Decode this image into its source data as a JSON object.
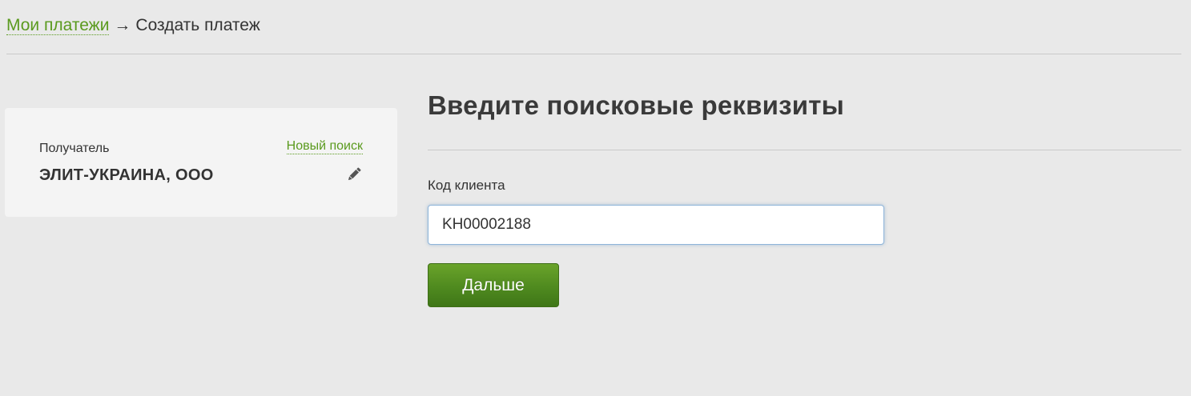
{
  "breadcrumb": {
    "link_label": "Мои платежи",
    "arrow": "→",
    "current": "Создать платеж"
  },
  "recipient": {
    "label": "Получатель",
    "new_search_label": "Новый поиск",
    "name": "ЭЛИТ-УКРАИНА, ООО",
    "edit_icon": "pencil-icon"
  },
  "form": {
    "title": "Введите поисковые реквизиты",
    "client_code_label": "Код клиента",
    "client_code_value": "KH00002188",
    "next_button_label": "Дальше"
  },
  "colors": {
    "accent_green": "#5a9a1e",
    "button_green": "#4f8a1f",
    "text_dark": "#333333",
    "background": "#e9e9e9",
    "card_background": "#f4f4f4"
  }
}
